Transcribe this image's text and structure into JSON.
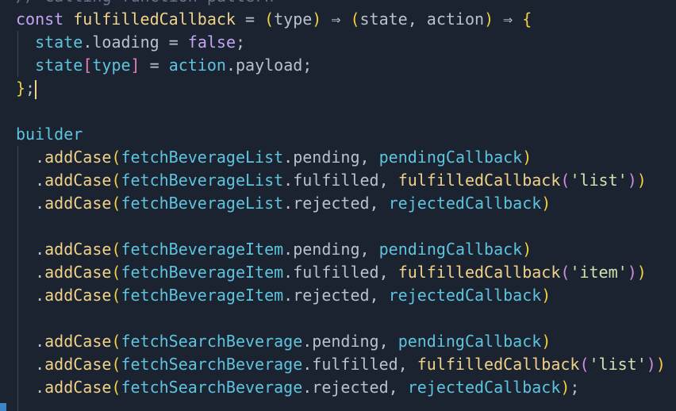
{
  "colors": {
    "background": "#1b2230",
    "keyword": "#c3a6f2",
    "func": "#f0d28a",
    "var": "#5ec4de",
    "prop": "#b9c1cd",
    "punct": "#b9c1cd",
    "paren1": "#f0d040",
    "paren2": "#d08ee0",
    "bracket": "#e07fbf",
    "string": "#cfe3b0",
    "bool": "#c3a6f2",
    "comment": "#6b7386"
  },
  "lines": [
    [
      [
        "comment",
        "// Calling function pattern"
      ]
    ],
    [
      [
        "keyword",
        "const "
      ],
      [
        "func",
        "fulfilledCallback"
      ],
      [
        "punct",
        " = "
      ],
      [
        "paren1",
        "("
      ],
      [
        "prop",
        "type"
      ],
      [
        "paren1",
        ")"
      ],
      [
        "punct",
        " ⇒ "
      ],
      [
        "paren1",
        "("
      ],
      [
        "prop",
        "state, action"
      ],
      [
        "paren1",
        ")"
      ],
      [
        "punct",
        " ⇒ "
      ],
      [
        "paren1",
        "{"
      ]
    ],
    [
      [
        "punct",
        "  "
      ],
      [
        "var",
        "state"
      ],
      [
        "punct",
        "."
      ],
      [
        "prop",
        "loading"
      ],
      [
        "punct",
        " = "
      ],
      [
        "bool",
        "false"
      ],
      [
        "punct",
        ";"
      ]
    ],
    [
      [
        "punct",
        "  "
      ],
      [
        "var",
        "state"
      ],
      [
        "bracket",
        "["
      ],
      [
        "var",
        "type"
      ],
      [
        "bracket",
        "]"
      ],
      [
        "punct",
        " = "
      ],
      [
        "var",
        "action"
      ],
      [
        "punct",
        "."
      ],
      [
        "prop",
        "payload"
      ],
      [
        "punct",
        ";"
      ]
    ],
    [
      [
        "paren1",
        "}"
      ],
      [
        "punct",
        ";"
      ],
      [
        "cursor",
        ""
      ]
    ],
    [],
    [
      [
        "var",
        "builder"
      ]
    ],
    [
      [
        "punct",
        "  ."
      ],
      [
        "func",
        "addCase"
      ],
      [
        "paren1",
        "("
      ],
      [
        "var",
        "fetchBeverageList"
      ],
      [
        "punct",
        "."
      ],
      [
        "prop",
        "pending"
      ],
      [
        "punct",
        ", "
      ],
      [
        "var",
        "pendingCallback"
      ],
      [
        "paren1",
        ")"
      ]
    ],
    [
      [
        "punct",
        "  ."
      ],
      [
        "func",
        "addCase"
      ],
      [
        "paren1",
        "("
      ],
      [
        "var",
        "fetchBeverageList"
      ],
      [
        "punct",
        "."
      ],
      [
        "prop",
        "fulfilled"
      ],
      [
        "punct",
        ", "
      ],
      [
        "func",
        "fulfilledCallback"
      ],
      [
        "paren2",
        "("
      ],
      [
        "string",
        "'list'"
      ],
      [
        "paren2",
        ")"
      ],
      [
        "paren1",
        ")"
      ]
    ],
    [
      [
        "punct",
        "  ."
      ],
      [
        "func",
        "addCase"
      ],
      [
        "paren1",
        "("
      ],
      [
        "var",
        "fetchBeverageList"
      ],
      [
        "punct",
        "."
      ],
      [
        "prop",
        "rejected"
      ],
      [
        "punct",
        ", "
      ],
      [
        "var",
        "rejectedCallback"
      ],
      [
        "paren1",
        ")"
      ]
    ],
    [],
    [
      [
        "punct",
        "  ."
      ],
      [
        "func",
        "addCase"
      ],
      [
        "paren1",
        "("
      ],
      [
        "var",
        "fetchBeverageItem"
      ],
      [
        "punct",
        "."
      ],
      [
        "prop",
        "pending"
      ],
      [
        "punct",
        ", "
      ],
      [
        "var",
        "pendingCallback"
      ],
      [
        "paren1",
        ")"
      ]
    ],
    [
      [
        "punct",
        "  ."
      ],
      [
        "func",
        "addCase"
      ],
      [
        "paren1",
        "("
      ],
      [
        "var",
        "fetchBeverageItem"
      ],
      [
        "punct",
        "."
      ],
      [
        "prop",
        "fulfilled"
      ],
      [
        "punct",
        ", "
      ],
      [
        "func",
        "fulfilledCallback"
      ],
      [
        "paren2",
        "("
      ],
      [
        "string",
        "'item'"
      ],
      [
        "paren2",
        ")"
      ],
      [
        "paren1",
        ")"
      ]
    ],
    [
      [
        "punct",
        "  ."
      ],
      [
        "func",
        "addCase"
      ],
      [
        "paren1",
        "("
      ],
      [
        "var",
        "fetchBeverageItem"
      ],
      [
        "punct",
        "."
      ],
      [
        "prop",
        "rejected"
      ],
      [
        "punct",
        ", "
      ],
      [
        "var",
        "rejectedCallback"
      ],
      [
        "paren1",
        ")"
      ]
    ],
    [],
    [
      [
        "punct",
        "  ."
      ],
      [
        "func",
        "addCase"
      ],
      [
        "paren1",
        "("
      ],
      [
        "var",
        "fetchSearchBeverage"
      ],
      [
        "punct",
        "."
      ],
      [
        "prop",
        "pending"
      ],
      [
        "punct",
        ", "
      ],
      [
        "var",
        "pendingCallback"
      ],
      [
        "paren1",
        ")"
      ]
    ],
    [
      [
        "punct",
        "  ."
      ],
      [
        "func",
        "addCase"
      ],
      [
        "paren1",
        "("
      ],
      [
        "var",
        "fetchSearchBeverage"
      ],
      [
        "punct",
        "."
      ],
      [
        "prop",
        "fulfilled"
      ],
      [
        "punct",
        ", "
      ],
      [
        "func",
        "fulfilledCallback"
      ],
      [
        "paren2",
        "("
      ],
      [
        "string",
        "'list'"
      ],
      [
        "paren2",
        ")"
      ],
      [
        "paren1",
        ")"
      ]
    ],
    [
      [
        "punct",
        "  ."
      ],
      [
        "func",
        "addCase"
      ],
      [
        "paren1",
        "("
      ],
      [
        "var",
        "fetchSearchBeverage"
      ],
      [
        "punct",
        "."
      ],
      [
        "prop",
        "rejected"
      ],
      [
        "punct",
        ", "
      ],
      [
        "var",
        "rejectedCallback"
      ],
      [
        "paren1",
        ")"
      ],
      [
        "punct",
        ";"
      ]
    ]
  ]
}
